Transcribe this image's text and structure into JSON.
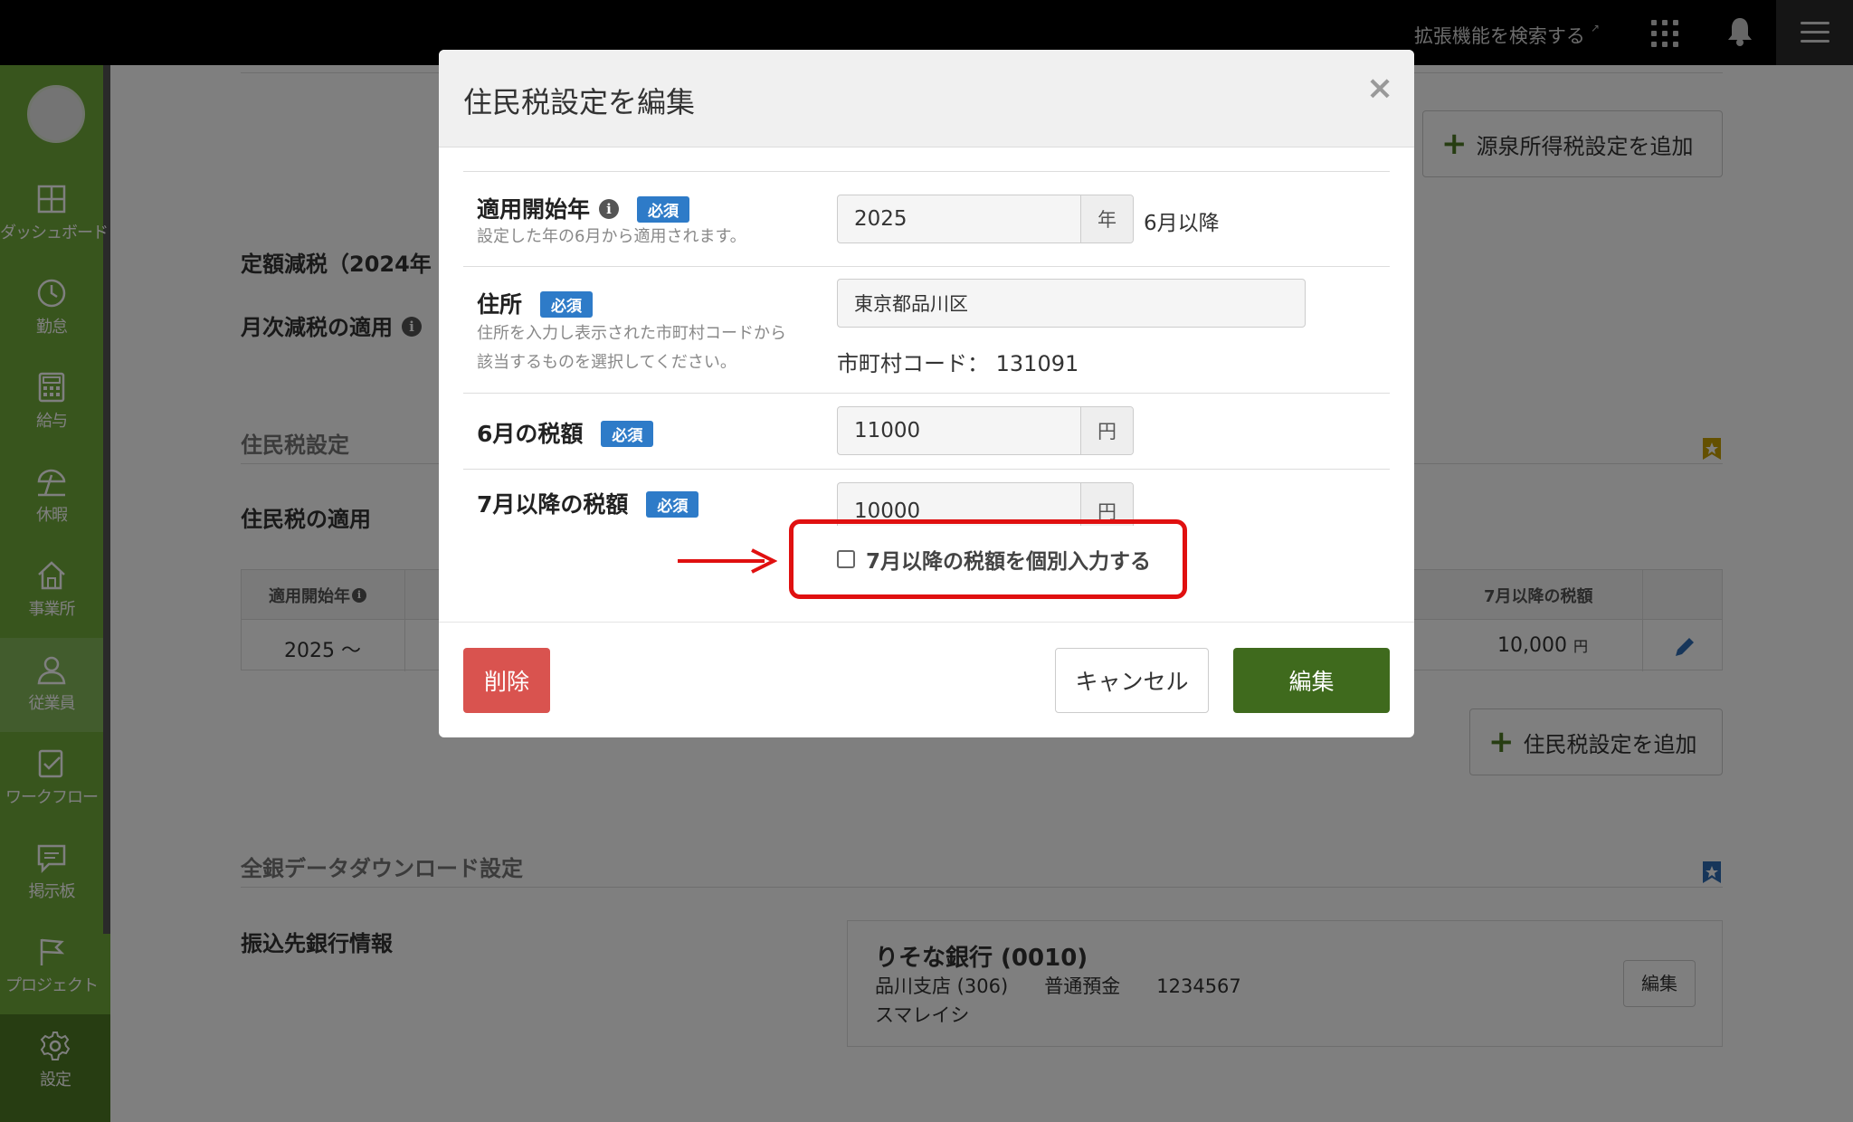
{
  "topbar": {
    "extension_search": "拡張機能を検索する"
  },
  "sidebar": {
    "items": [
      {
        "label": "ダッシュボード",
        "icon": "dashboard-icon"
      },
      {
        "label": "勤怠",
        "icon": "clock-icon"
      },
      {
        "label": "給与",
        "icon": "calculator-icon"
      },
      {
        "label": "休暇",
        "icon": "umbrella-icon"
      },
      {
        "label": "事業所",
        "icon": "home-icon"
      },
      {
        "label": "従業員",
        "icon": "person-icon"
      },
      {
        "label": "ワークフロー",
        "icon": "checklist-icon"
      },
      {
        "label": "掲示板",
        "icon": "message-icon"
      },
      {
        "label": "プロジェクト",
        "icon": "flag-icon"
      },
      {
        "label": "設定",
        "icon": "gear-icon"
      }
    ],
    "active_item": "従業員"
  },
  "background": {
    "add_withholding_button": "源泉所得税設定を追加",
    "fixed_tax_reduction_label": "定額減税（2024年",
    "monthly_reduction_label": "月次減税の適用",
    "resident_tax_section": "住民税設定",
    "resident_tax_apply_label": "住民税の適用",
    "table": {
      "headers": [
        "適用開始年",
        "7月以降の税額"
      ],
      "row": {
        "start_year": "2025 〜",
        "july_tax": "10,000",
        "july_tax_unit": "円"
      }
    },
    "add_resident_tax_button": "住民税設定を追加",
    "zengin_section": "全銀データダウンロード設定",
    "bank_info_label": "振込先銀行情報",
    "bank": {
      "name": "りそな銀行 (0010)",
      "branch_line": "品川支店 (306)      普通預金      1234567",
      "holder": "スマレイシ",
      "edit_button": "編集"
    }
  },
  "modal": {
    "title": "住民税設定を編集",
    "close_symbol": "×",
    "required_badge": "必須",
    "fields": {
      "start_year": {
        "label": "適用開始年",
        "help": "設定した年の6月から適用されます。",
        "value": "2025",
        "addon": "年",
        "suffix": "6月以降"
      },
      "address": {
        "label": "住所",
        "help_line1": "住所を入力し表示された市町村コードから",
        "help_line2": "該当するものを選択してください。",
        "value": "東京都品川区",
        "municipality_code_label": "市町村コード：",
        "municipality_code": "131091"
      },
      "june_tax": {
        "label": "6月の税額",
        "value": "11000",
        "addon": "円"
      },
      "july_tax": {
        "label": "7月以降の税額",
        "value": "10000",
        "addon": "円",
        "checkbox_label": "7月以降の税額を個別入力する",
        "checkbox_checked": false
      }
    },
    "buttons": {
      "delete": "削除",
      "cancel": "キャンセル",
      "edit": "編集"
    }
  },
  "colors": {
    "sidebar_green": "#70aa3a",
    "primary_dark_green": "#3f6a1d",
    "danger_red": "#d9534f",
    "required_blue": "#2e7bc8",
    "annotation_red": "#e01010"
  }
}
